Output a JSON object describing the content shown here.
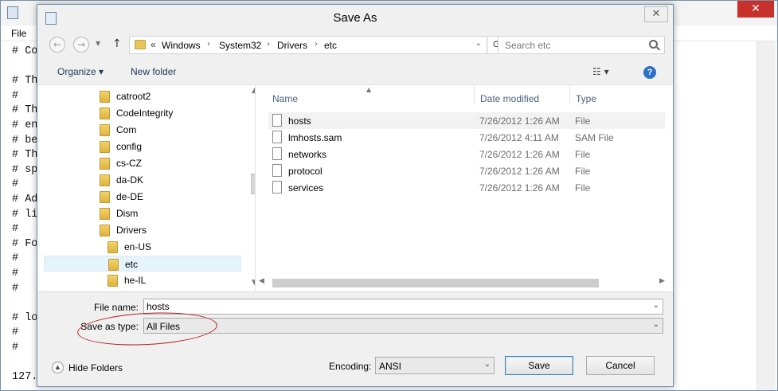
{
  "notepad": {
    "menu": {
      "file_label": "File"
    },
    "close_glyph": "✕",
    "text_lines": [
      "# Co",
      "",
      "# Th",
      "#",
      "# Th",
      "# en",
      "# be",
      "# Th",
      "# sp",
      "#",
      "# Ad",
      "# li",
      "#",
      "# Fo",
      "#",
      "#",
      "#",
      "",
      "# lo",
      "#",
      "#",
      "",
      "127."
    ]
  },
  "dialog": {
    "title": "Save As",
    "close_glyph": "✕",
    "nav": {
      "back_glyph": "←",
      "forward_glyph": "→",
      "recent_glyph": "▼",
      "up_glyph": "↑",
      "chevron": "«",
      "breadcrumbs": [
        "Windows",
        "System32",
        "Drivers",
        "etc"
      ],
      "crumb_sep": "›",
      "address_drop": "⌄",
      "refresh_glyph": "⟳",
      "search_placeholder": "Search etc"
    },
    "toolbar": {
      "organize_label": "Organize ▾",
      "new_folder_label": "New folder",
      "view_label": "☷ ▾",
      "help_label": "?"
    },
    "tree": {
      "items": [
        {
          "label": "catroot2",
          "level": 0
        },
        {
          "label": "CodeIntegrity",
          "level": 0
        },
        {
          "label": "Com",
          "level": 0
        },
        {
          "label": "config",
          "level": 0
        },
        {
          "label": "cs-CZ",
          "level": 0
        },
        {
          "label": "da-DK",
          "level": 0
        },
        {
          "label": "de-DE",
          "level": 0
        },
        {
          "label": "Dism",
          "level": 0
        },
        {
          "label": "Drivers",
          "level": 0
        },
        {
          "label": "en-US",
          "level": 1
        },
        {
          "label": "etc",
          "level": 1,
          "selected": true
        },
        {
          "label": "he-IL",
          "level": 1
        }
      ],
      "scroll_up": "▲",
      "scroll_down": "▼"
    },
    "files": {
      "columns": {
        "name": "Name",
        "date": "Date modified",
        "type": "Type"
      },
      "sort_glyph": "▲",
      "rows": [
        {
          "name": "hosts",
          "date": "7/26/2012 1:26 AM",
          "type": "File"
        },
        {
          "name": "lmhosts.sam",
          "date": "7/26/2012 4:11 AM",
          "type": "SAM File"
        },
        {
          "name": "networks",
          "date": "7/26/2012 1:26 AM",
          "type": "File"
        },
        {
          "name": "protocol",
          "date": "7/26/2012 1:26 AM",
          "type": "File"
        },
        {
          "name": "services",
          "date": "7/26/2012 1:26 AM",
          "type": "File"
        }
      ],
      "scroll_left": "◀",
      "scroll_right": "▶"
    },
    "bottom": {
      "file_name_label": "File name:",
      "file_name_value": "hosts",
      "dropdown_glyph": "⌄",
      "save_as_type_label": "Save as type:",
      "save_as_type_value": "All Files",
      "hide_folders_glyph": "▲",
      "hide_folders_label": "Hide Folders",
      "encoding_label": "Encoding:",
      "encoding_value": "ANSI",
      "save_label": "Save",
      "cancel_label": "Cancel"
    }
  },
  "colors": {
    "annotation": "#b51c1c",
    "selection": "#e5f3fb",
    "close_red": "#c7302b"
  }
}
